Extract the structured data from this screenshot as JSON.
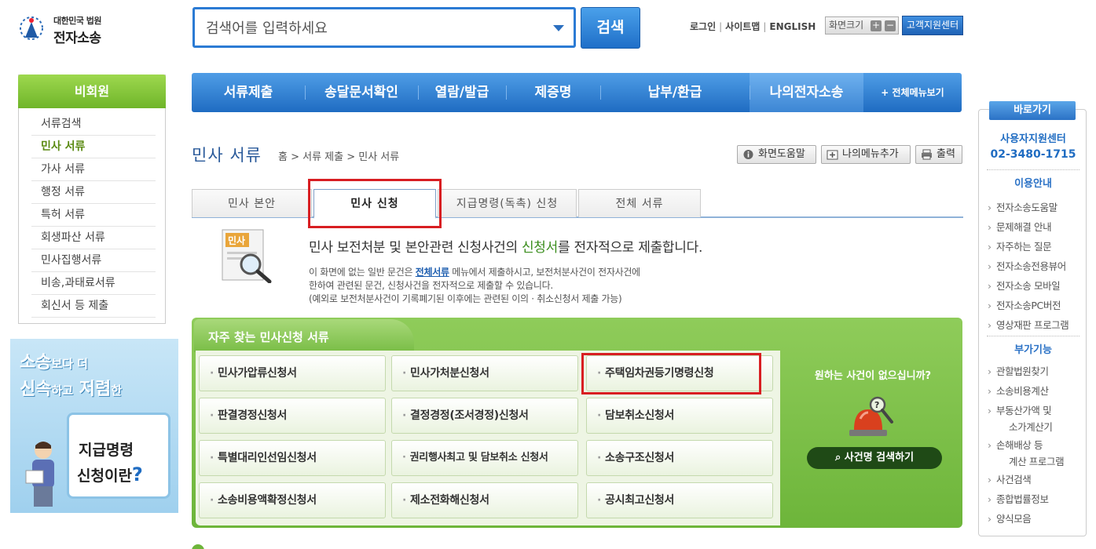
{
  "header": {
    "logo_court": "대한민국 법원",
    "logo_site": "전자소송",
    "search_placeholder": "검색어를 입력하세요",
    "search_button": "검색",
    "links": [
      "로그인",
      "사이트맵",
      "ENGLISH"
    ],
    "zoom_label": "화면크기",
    "zoom_in": "+",
    "zoom_out": "−",
    "support": "고객지원센터"
  },
  "gnb": {
    "items": [
      "서류제출",
      "송달문서확인",
      "열람/발급",
      "제증명",
      "납부/환급",
      "나의전자소송"
    ],
    "all_menu": "+ 전체메뉴보기"
  },
  "lnb": {
    "title": "비회원",
    "items": [
      "서류검색",
      "민사 서류",
      "가사 서류",
      "행정 서류",
      "특허 서류",
      "회생파산 서류",
      "민사집행서류",
      "비송,과태료서류",
      "회신서 등 제출"
    ]
  },
  "promo": {
    "line1_big": "소송",
    "line1_small": "보다 더",
    "line2_a": "신속",
    "line2_b": "하고",
    "line2_c": "저렴",
    "line2_d": "한",
    "board1": "지급명령",
    "board2": "신청이란",
    "board_q": "?"
  },
  "content": {
    "title": "민사 서류",
    "breadcrumb": "홈 > 서류 제출 > 민사 서류",
    "util_help": "화면도움말",
    "util_addmenu": "나의메뉴추가",
    "util_print": "출력"
  },
  "tabs": [
    "민사 본안",
    "민사 신청",
    "지급명령(독촉) 신청",
    "전체 서류"
  ],
  "description": {
    "title_pre": "민사 보전처분 및 본안관련 신청사건의 ",
    "title_hl": "신청서",
    "title_post": "를 전자적으로 제출합니다.",
    "line1_pre": "이 화면에 없는 일반 문건은 ",
    "line1_link": "전체서류",
    "line1_post": " 메뉴에서 제출하시고, 보전처분사건이 전자사건에",
    "line2": "한하여 관련된 문건, 신청사건을 전자적으로 제출할 수 있습니다.",
    "line3": "(예외로 보전처분사건이 기록폐기된 이후에는 관련된 이의 · 취소신청서 제출 가능)",
    "icon_label": "민사"
  },
  "panel": {
    "title": "자주 찾는 민사신청 서류",
    "docs": [
      "민사가압류신청서",
      "민사가처분신청서",
      "주택임차권등기명령신청",
      "판결경정신청서",
      "결정경정(조서경정)신청서",
      "담보취소신청서",
      "특별대리인선임신청서",
      "권리행사최고 및 담보취소 신청서",
      "소송구조신청서",
      "소송비용액확정신청서",
      "제소전화해신청서",
      "공시최고신청서"
    ],
    "side_question": "원하는 사건이 없으십니까?",
    "side_button": "사건명 검색하기"
  },
  "quick": {
    "title": "바로가기",
    "center": "사용자지원센터",
    "phone": "02-3480-1715",
    "sec1": "이용안내",
    "guide": [
      "전자소송도움말",
      "문제해결 안내",
      "자주하는 질문",
      "전자소송전용뷰어",
      "전자소송 모바일",
      "전자소송PC버전",
      "영상재판 프로그램"
    ],
    "sec2": "부가기능",
    "extra": [
      {
        "a": "관할법원찾기",
        "b": ""
      },
      {
        "a": "소송비용계산",
        "b": ""
      },
      {
        "a": "부동산가액 및",
        "b": "소가계산기"
      },
      {
        "a": "손해배상 등",
        "b": "계산 프로그램"
      },
      {
        "a": "사건검색",
        "b": ""
      },
      {
        "a": "종합법률정보",
        "b": ""
      },
      {
        "a": "양식모음",
        "b": ""
      }
    ]
  },
  "colors": {
    "primary_blue": "#2b7bd4",
    "green": "#6db53a",
    "highlight_red": "#d81e22"
  }
}
